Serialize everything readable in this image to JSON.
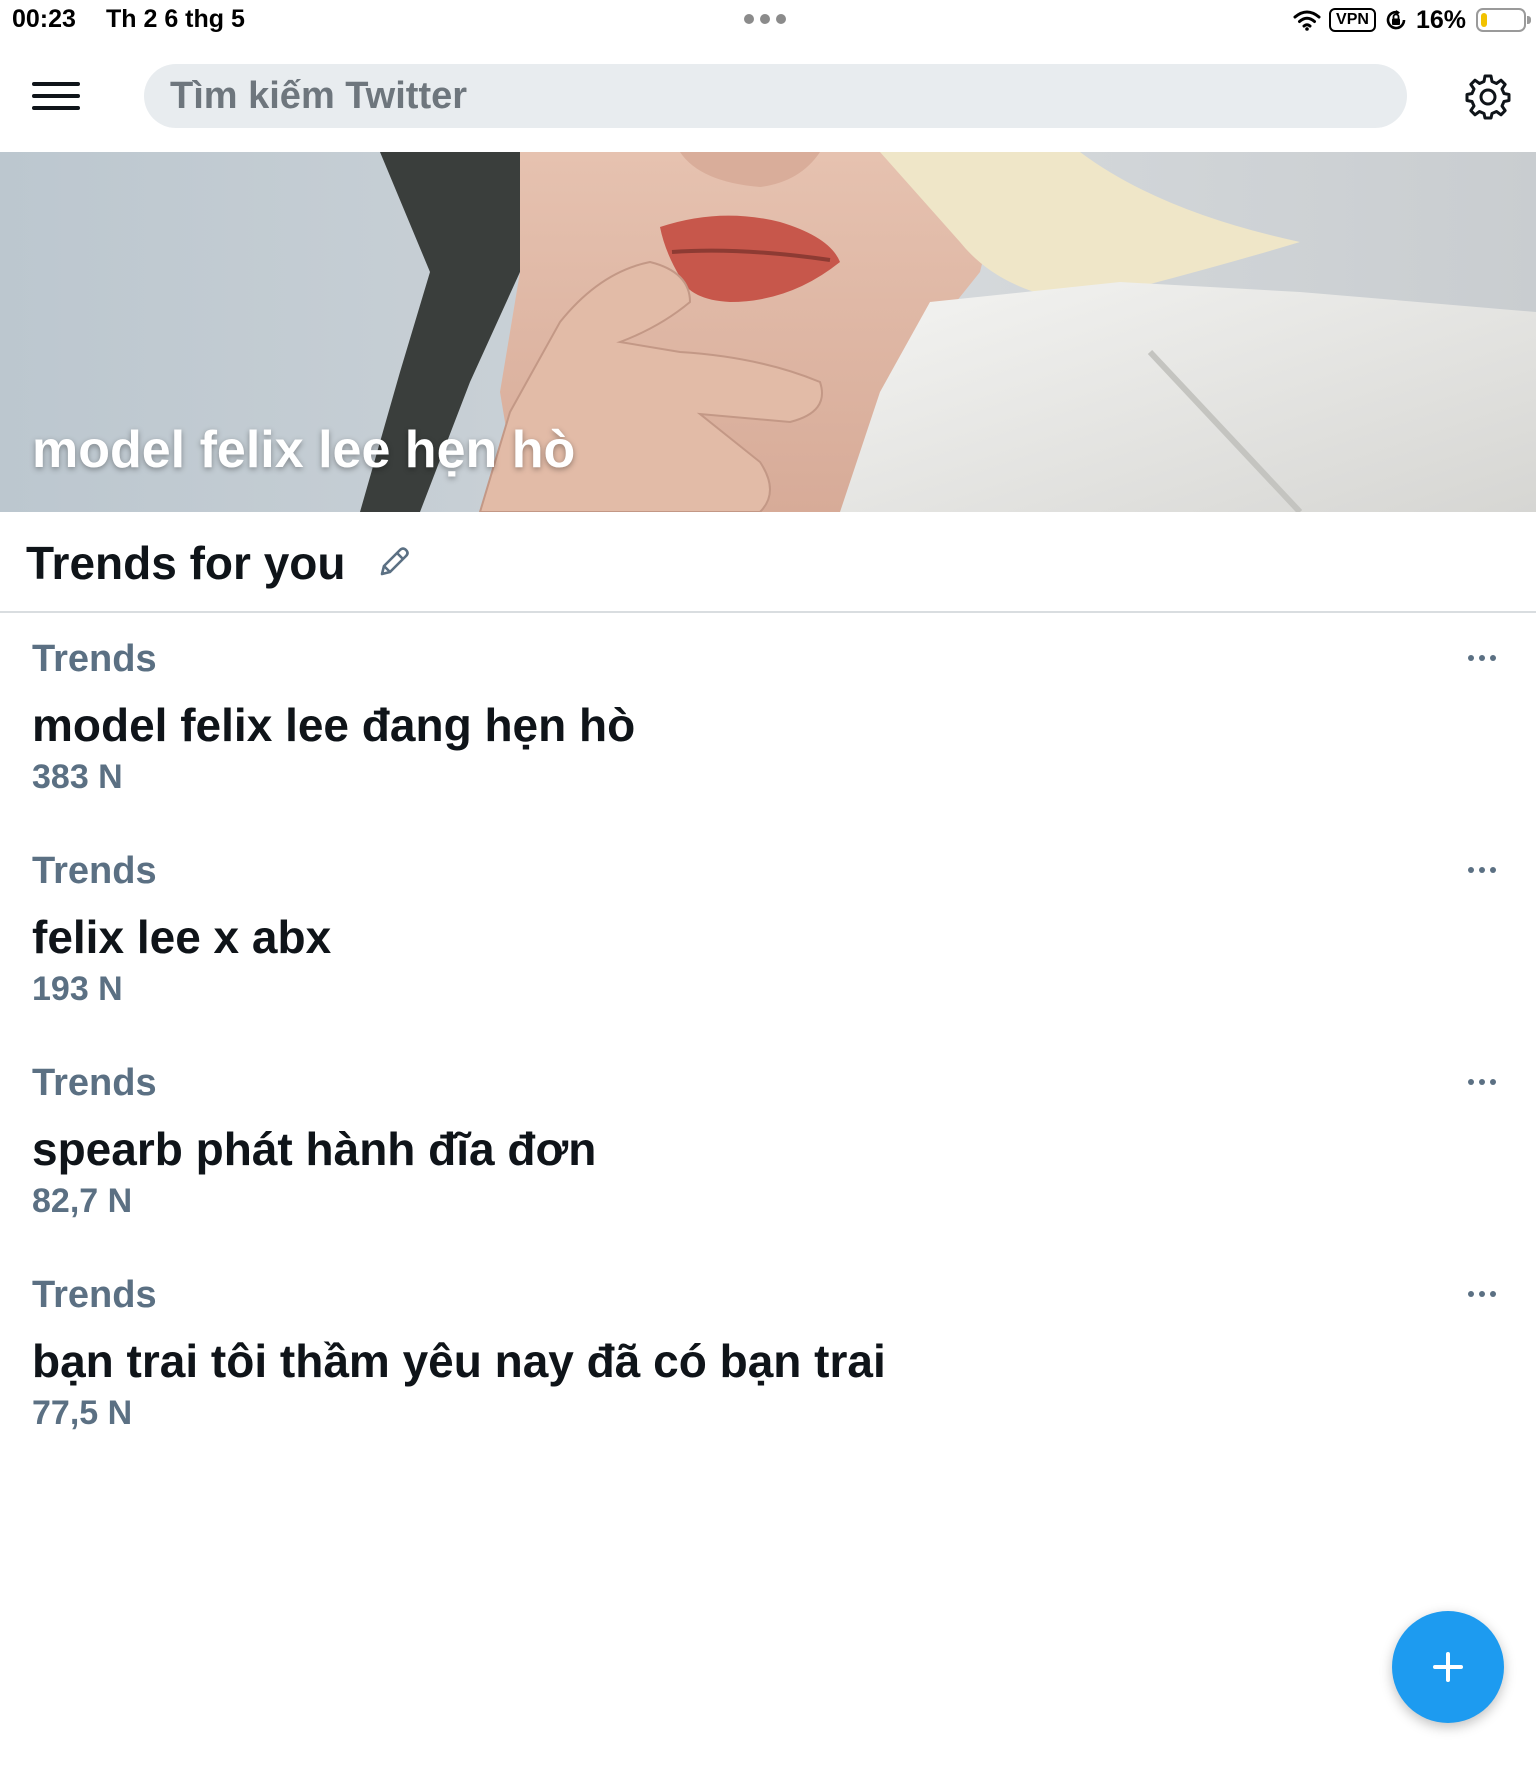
{
  "status_bar": {
    "time": "00:23",
    "date": "Th 2 6 thg 5",
    "vpn_label": "VPN",
    "battery_percent": "16%",
    "battery_level": 0.16,
    "battery_color": "#f2c200"
  },
  "top_nav": {
    "menu_icon": "hamburger-menu-icon",
    "search_placeholder": "Tìm kiếm Twitter",
    "settings_icon": "gear-icon"
  },
  "hero": {
    "title": "model felix lee hẹn hò"
  },
  "trends_section": {
    "title": "Trends for you",
    "edit_icon": "pencil-icon"
  },
  "trends": [
    {
      "category": "Trends",
      "name": "model felix lee đang hẹn hò",
      "count": "383 N"
    },
    {
      "category": "Trends",
      "name": "felix lee x abx",
      "count": "193 N"
    },
    {
      "category": "Trends",
      "name": "spearb phát hành đĩa đơn",
      "count": "82,7 N"
    },
    {
      "category": "Trends",
      "name": "bạn trai tôi thầm yêu nay đã có bạn trai",
      "count": "77,5 N"
    }
  ],
  "fab": {
    "icon": "plus-icon"
  },
  "colors": {
    "accent": "#1d9bf0",
    "secondary_text": "#5b7083",
    "primary_text": "#0f1419",
    "search_bg": "#e8ecef"
  }
}
